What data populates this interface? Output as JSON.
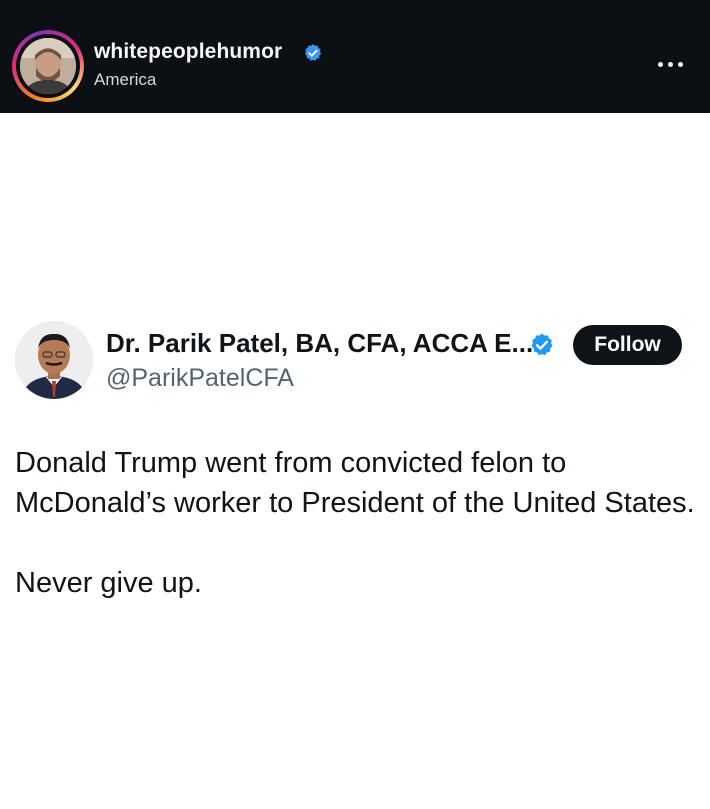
{
  "post_header": {
    "username": "whitepeoplehumor",
    "location": "America",
    "more_icon": "more-horizontal-icon",
    "verified_icon": "verified-badge-icon",
    "ring_colors": [
      "#f58529",
      "#dd2a7b",
      "#8134af",
      "#feda77"
    ],
    "verified_color": "#1d9bf0"
  },
  "tweet": {
    "display_name": "Dr. Parik Patel, BA, CFA, ACCA E...",
    "handle": "@ParikPatelCFA",
    "follow_label": "Follow",
    "verified_icon": "verified-badge-icon",
    "verified_color": "#1d9bf0",
    "paragraphs": [
      "Donald Trump went from convicted felon to McDonald’s worker to President of the United States.",
      "Never give up."
    ]
  }
}
